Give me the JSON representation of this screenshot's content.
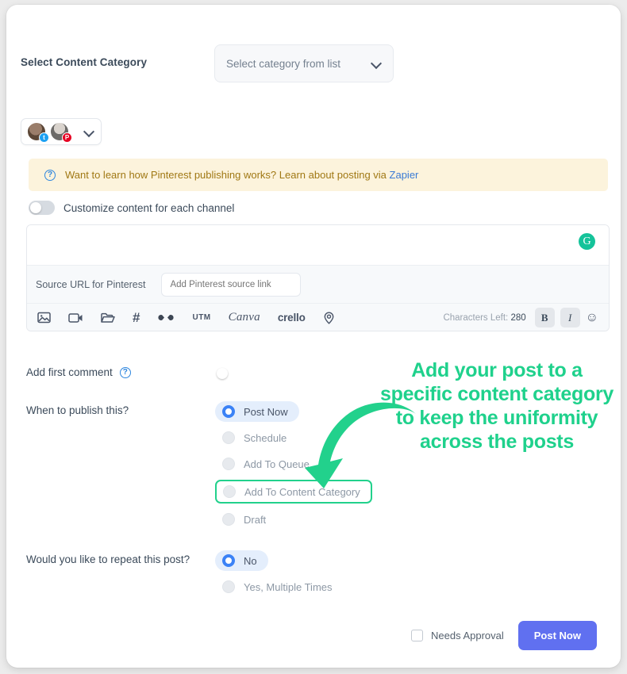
{
  "category_row": {
    "label": "Select Content Category",
    "select_placeholder": "Select category from list",
    "chevron_icon": "chevron-down-icon"
  },
  "accounts": {
    "avatars": [
      {
        "network": "twitter",
        "badge_glyph": "t"
      },
      {
        "network": "pinterest",
        "badge_glyph": "P"
      }
    ],
    "chevron_icon": "chevron-down-icon"
  },
  "notice": {
    "icon": "question-circle-icon",
    "text": "Want to learn how Pinterest publishing works? Learn about posting via ",
    "link_text": "Zapier"
  },
  "customize_toggle": {
    "label": "Customize content for each channel",
    "state": "off"
  },
  "composer": {
    "grammarly_icon": "grammarly-icon",
    "grammarly_glyph": "G",
    "source_label": "Source URL for Pinterest",
    "source_placeholder": "Add Pinterest source link",
    "toolbar": [
      {
        "name": "image-icon",
        "kind": "svg",
        "label": ""
      },
      {
        "name": "video-icon",
        "kind": "svg",
        "label": ""
      },
      {
        "name": "folder-icon",
        "kind": "svg",
        "label": ""
      },
      {
        "name": "hashtag-icon",
        "kind": "glyph",
        "label": "#"
      },
      {
        "name": "link-icon",
        "kind": "svg",
        "label": ""
      },
      {
        "name": "utm-button",
        "kind": "text",
        "label": "UTM"
      },
      {
        "name": "canva-button",
        "kind": "canva",
        "label": "Canva"
      },
      {
        "name": "crello-button",
        "kind": "crello",
        "label": "crello"
      },
      {
        "name": "location-icon",
        "kind": "svg",
        "label": ""
      }
    ],
    "chars_label": "Characters Left:",
    "chars_value": "280",
    "bold_label": "B",
    "italic_label": "I",
    "emoji_icon": "emoji-smile-icon"
  },
  "first_comment": {
    "label": "Add first comment",
    "help_icon": "question-circle-icon",
    "help_glyph": "?",
    "state": "off"
  },
  "when_to_publish": {
    "label": "When to publish this?",
    "options": [
      {
        "label": "Post Now",
        "selected": true,
        "highlighted": false
      },
      {
        "label": "Schedule",
        "selected": false,
        "highlighted": false
      },
      {
        "label": "Add To Queue",
        "selected": false,
        "highlighted": false
      },
      {
        "label": "Add To Content Category",
        "selected": false,
        "highlighted": true
      },
      {
        "label": "Draft",
        "selected": false,
        "highlighted": false
      }
    ]
  },
  "repeat_post": {
    "label": "Would you like to repeat this post?",
    "options": [
      {
        "label": "No",
        "selected": true
      },
      {
        "label": "Yes, Multiple Times",
        "selected": false
      }
    ]
  },
  "annotation": {
    "text": "Add your post to a specific content category to keep the uniformity across the posts",
    "color": "#1fd18c",
    "arrow_icon": "curved-arrow-down-left-icon"
  },
  "footer": {
    "needs_approval_label": "Needs Approval",
    "needs_approval_checked": false,
    "post_button_label": "Post Now",
    "post_button_color": "#6070f0"
  }
}
